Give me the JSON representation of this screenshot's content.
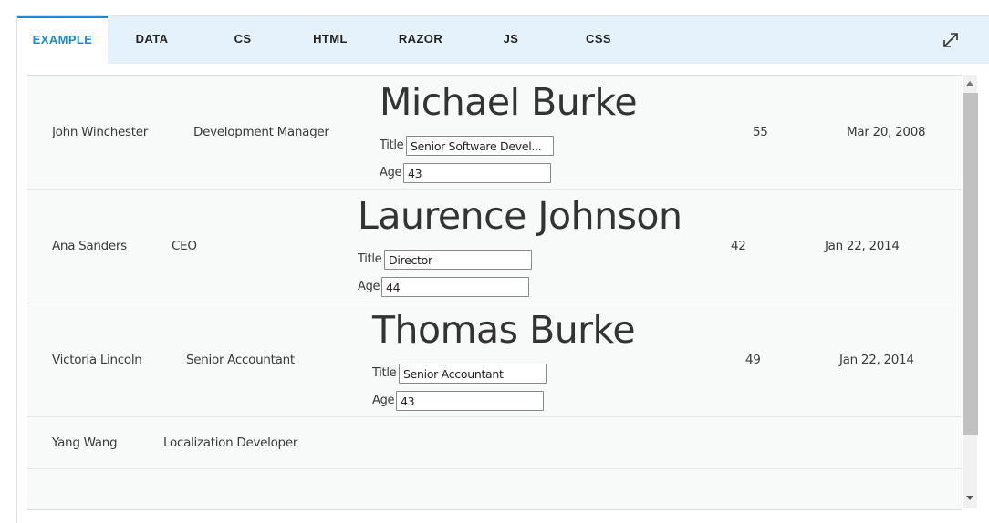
{
  "tabs": [
    {
      "label": "EXAMPLE",
      "active": true
    },
    {
      "label": "DATA",
      "active": false
    },
    {
      "label": "CS",
      "active": false
    },
    {
      "label": "HTML",
      "active": false
    },
    {
      "label": "RAZOR",
      "active": false
    },
    {
      "label": "JS",
      "active": false
    },
    {
      "label": "CSS",
      "active": false
    }
  ],
  "toolbar": {
    "expand_icon": "expand-icon"
  },
  "detail_labels": {
    "title": "Title",
    "age": "Age"
  },
  "rows": [
    {
      "name": "John Winchester",
      "title": "Development Manager",
      "detail": {
        "name": "Michael Burke",
        "title": "Senior Software Devel...",
        "age": "43"
      },
      "age": "55",
      "hire_date": "Mar 20, 2008"
    },
    {
      "name": "Ana Sanders",
      "title": "CEO",
      "detail": {
        "name": "Laurence Johnson",
        "title": "Director",
        "age": "44"
      },
      "age": "42",
      "hire_date": "Jan 22, 2014"
    },
    {
      "name": "Victoria Lincoln",
      "title": "Senior Accountant",
      "detail": {
        "name": "Thomas Burke",
        "title": "Senior Accountant",
        "age": "43"
      },
      "age": "49",
      "hire_date": "Jan 22, 2014"
    },
    {
      "name": "Yang Wang",
      "title": "Localization Developer"
    }
  ],
  "colors": {
    "accent": "#1a8ad6",
    "tabbar_bg": "#e6f2fb",
    "grid_bg": "#f8f9f9",
    "scroll_thumb": "#c1c1c1"
  }
}
